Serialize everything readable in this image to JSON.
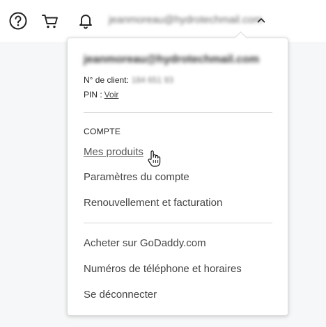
{
  "header": {
    "icons": [
      "help-icon",
      "cart-icon",
      "bell-icon",
      "caret-up-icon"
    ],
    "account_email": "jeanmoreau@hydrotechmail.com"
  },
  "account_menu": {
    "email": "jeanmoreau@hydrotechmail.com",
    "client_label": "N° de client:",
    "client_number": "184 651 93",
    "pin_label": "PIN :",
    "pin_link": "Voir",
    "section_title": "COMPTE",
    "account_items": [
      "Mes produits",
      "Paramètres du compte",
      "Renouvellement et facturation"
    ],
    "other_items": [
      "Acheter sur GoDaddy.com",
      "Numéros de téléphone et horaires",
      "Se déconnecter"
    ]
  },
  "colors": {
    "page_background": "#f5f7f8",
    "panel_background": "#ffffff",
    "text": "#444444"
  }
}
